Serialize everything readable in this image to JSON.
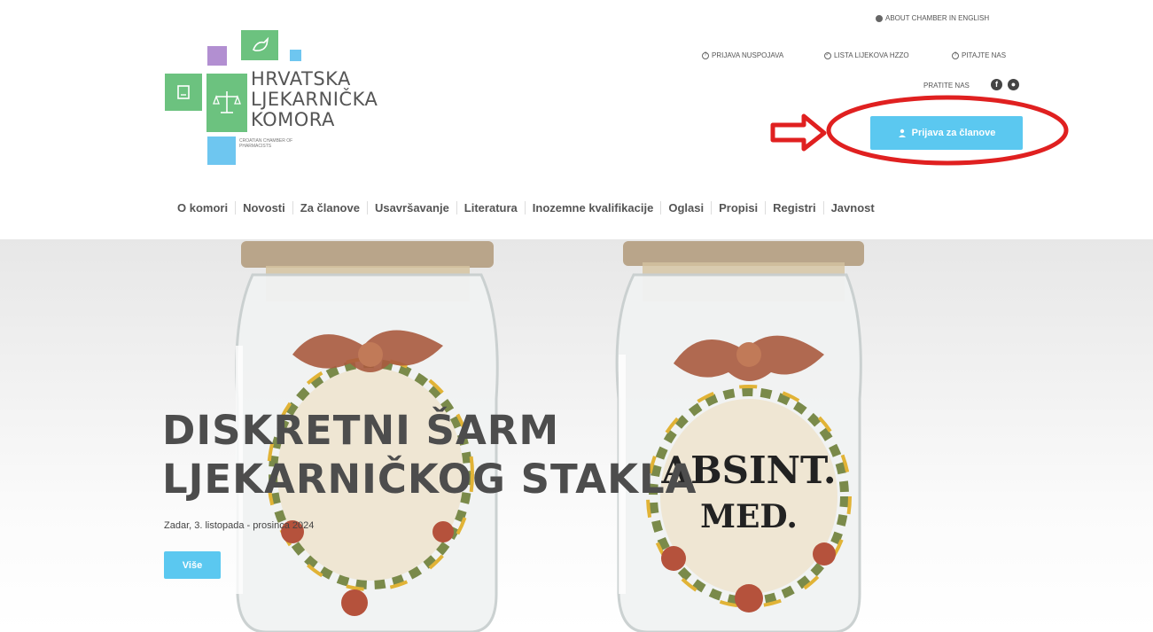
{
  "top_bar": {
    "english_link": "ABOUT CHAMBER IN ENGLISH",
    "links": [
      "PRIJAVA NUSPOJAVA",
      "LISTA LIJEKOVA HZZO",
      "PITAJTE NAS"
    ],
    "follow_label": "PRATITE NAS",
    "social_icons": [
      "facebook-icon",
      "social-icon"
    ]
  },
  "logo": {
    "line1": "HRVATSKA",
    "line2": "LJEKARNIČKA",
    "line3": "KOMORA",
    "subtitle": "CROATIAN CHAMBER OF PHARMACISTS",
    "colors": {
      "green": "#6cc27f",
      "purple": "#b28fd1",
      "blue": "#6ec6f0"
    }
  },
  "login_button": {
    "label": "Prijava za članove",
    "icon": "user-icon"
  },
  "nav": {
    "items": [
      "O komori",
      "Novosti",
      "Za članove",
      "Usavršavanje",
      "Literatura",
      "Inozemne kvalifikacije",
      "Oglasi",
      "Propisi",
      "Registri",
      "Javnost"
    ]
  },
  "hero": {
    "title_line1": "DISKRETNI ŠARM",
    "title_line2": "LJEKARNIČKOG STAKLA",
    "date": "Zadar, 3. listopada - prosinca 2024",
    "button": "Više",
    "jar_labels": [
      "ABSINT.",
      "MED."
    ]
  },
  "annotation": {
    "color": "#e02020"
  },
  "accent": "#5bc8f0"
}
